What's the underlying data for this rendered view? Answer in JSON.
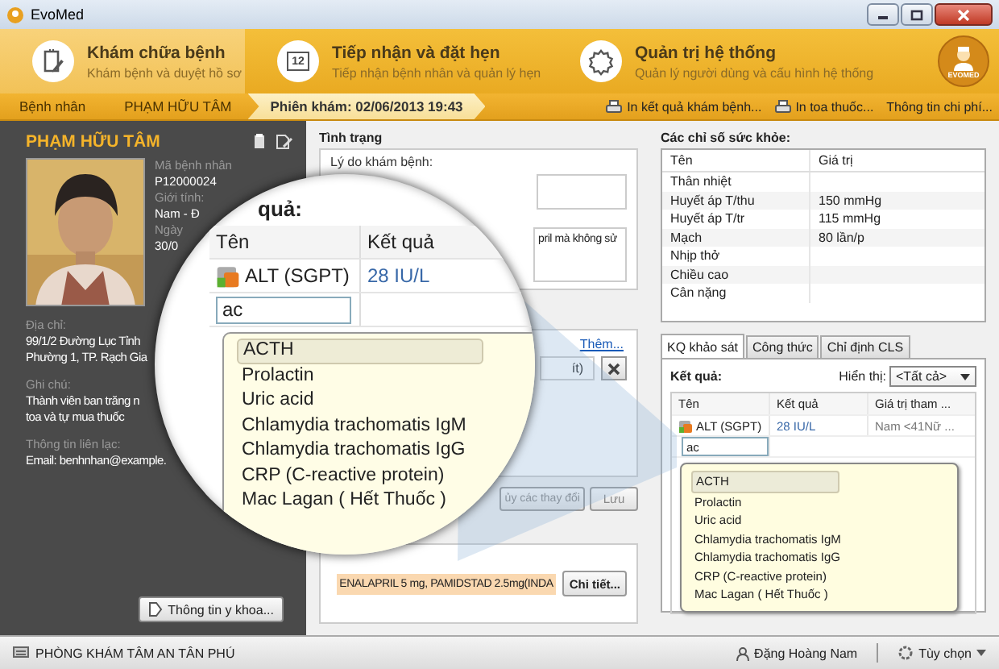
{
  "window": {
    "title": "EvoMed"
  },
  "modules": [
    {
      "title": "Khám chữa bệnh",
      "subtitle": "Khám bệnh và duyệt hồ sơ",
      "selected": true
    },
    {
      "title": "Tiếp nhận và đặt hẹn",
      "subtitle": "Tiếp nhận bệnh nhân và quản lý hẹn",
      "calendar_day": "12",
      "selected": false
    },
    {
      "title": "Quản trị hệ thống",
      "subtitle": "Quản lý người dùng và cấu hình hệ thống",
      "selected": false
    }
  ],
  "logo": {
    "text": "EVOMED"
  },
  "breadcrumb": [
    {
      "label": "Bệnh nhân",
      "selected": false
    },
    {
      "label": "PHẠM HỮU TÂM",
      "selected": false
    },
    {
      "label": "Phiên khám: 02/06/2013 19:43",
      "selected": true
    }
  ],
  "actions": [
    {
      "label": "In kết quả khám bệnh..."
    },
    {
      "label": "In toa thuốc..."
    },
    {
      "label": "Thông tin chi phí..."
    }
  ],
  "patient": {
    "name": "PHẠM HỮU TÂM",
    "fields": [
      {
        "label": "Mã bệnh nhân",
        "value": "P12000024"
      },
      {
        "label": "Giới tính:",
        "value": "Nam - Đ"
      },
      {
        "label": "Ngày",
        "value": "30/0"
      }
    ],
    "sections": [
      {
        "label": "Địa chỉ:",
        "lines": [
          "99/1/2 Đường Lục Tỉnh",
          "Phường 1, TP. Rạch Gia"
        ]
      },
      {
        "label": "Ghi chú:",
        "lines": [
          "Thành viên ban trăng n",
          "toa và tự mua thuốc"
        ]
      },
      {
        "label": "Thông tin liên lạc:",
        "lines": [
          "Email: benhnhan@example."
        ]
      }
    ],
    "medical_button": "Thông tin y khoa..."
  },
  "exam": {
    "title": "Tình trạng",
    "reason_label": "Lý do khám bệnh:",
    "note_excerpt": "pril mà không sử",
    "add_link": "Thêm...",
    "field_excerpt": "ít)",
    "cancel_button": "ủy các thay đổi",
    "save_button": "Lưu",
    "prescription": "ENALAPRIL 5 mg, PAMIDSTAD 2.5mg(INDA",
    "details_button": "Chi tiết..."
  },
  "health": {
    "title": "Các chỉ số sức khỏe:",
    "columns": [
      "Tên",
      "Giá trị"
    ],
    "rows": [
      {
        "name": "Thân nhiệt"
      },
      {
        "name": "Huyết áp T/thu",
        "value": "150 mmHg"
      },
      {
        "name": "Huyết áp T/tr",
        "value": "115 mmHg"
      },
      {
        "name": "Mạch",
        "value": "80 lần/p"
      },
      {
        "name": "Nhịp thở"
      },
      {
        "name": "Chiều cao"
      },
      {
        "name": "Cân nặng"
      }
    ]
  },
  "tabs": [
    {
      "label": "KQ khảo sát",
      "selected": true
    },
    {
      "label": "Công thức",
      "selected": false
    },
    {
      "label": "Chỉ định CLS",
      "selected": false
    }
  ],
  "results": {
    "label": "Kết quả:",
    "filter_label": "Hiển thị:",
    "filter_value": "<Tất cả>",
    "columns": [
      "Tên",
      "Kết quả",
      "Giá trị tham ..."
    ],
    "rows": [
      {
        "name": "ALT (SGPT)",
        "result": "28 IU/L",
        "reference": "Nam <41Nữ ..."
      }
    ],
    "search_value": "ac",
    "suggestions": [
      {
        "label": "ACTH",
        "selected": true
      },
      {
        "label": "Prolactin",
        "selected": false
      },
      {
        "label": "Uric acid",
        "selected": false
      },
      {
        "label": "Chlamydia trachomatis IgM",
        "selected": false
      },
      {
        "label": "Chlamydia trachomatis IgG",
        "selected": false
      },
      {
        "label": "CRP (C-reactive protein)",
        "selected": false
      },
      {
        "label": "Mac Lagan ( Hết Thuốc )",
        "selected": false
      }
    ]
  },
  "magnifier": {
    "title": "quả:",
    "columns": [
      "Tên",
      "Kết quả"
    ],
    "row": {
      "name": "ALT (SGPT)",
      "result": "28 IU/L"
    },
    "search_value": "ac",
    "suggestions": [
      {
        "label": "ACTH",
        "selected": true
      },
      {
        "label": "Prolactin",
        "selected": false
      },
      {
        "label": "Uric acid",
        "selected": false
      },
      {
        "label": "Chlamydia trachomatis IgM",
        "selected": false
      },
      {
        "label": "Chlamydia trachomatis IgG",
        "selected": false
      },
      {
        "label": "CRP (C-reactive protein)",
        "selected": false
      },
      {
        "label": "Mac Lagan ( Hết Thuốc )",
        "selected": false
      }
    ]
  },
  "status_bar": {
    "clinic": "PHÒNG KHÁM TÂM AN TÂN PHÚ",
    "user": "Đặng Hoàng Nam",
    "options": "Tùy chọn"
  }
}
